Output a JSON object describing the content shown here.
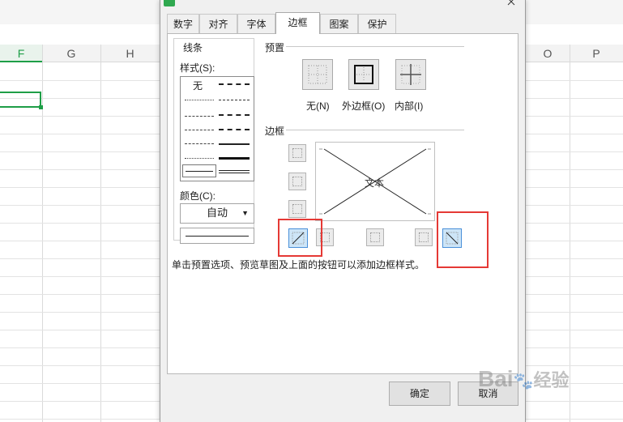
{
  "sheet": {
    "columns": [
      "F",
      "G",
      "H",
      "O",
      "P"
    ]
  },
  "dialog": {
    "tabs": [
      "数字",
      "对齐",
      "字体",
      "边框",
      "图案",
      "保护"
    ],
    "active_tab": "边框",
    "line_group": {
      "title": "线条",
      "style_label": "样式(S):",
      "none_label": "无",
      "color_label": "颜色(C):",
      "color_value": "自动"
    },
    "preset_group": {
      "title": "预置",
      "none": "无(N)",
      "outline": "外边框(O)",
      "inside": "内部(I)"
    },
    "border_group": {
      "title": "边框",
      "preview_text": "文本"
    },
    "hint": "单击预置选项、预览草图及上面的按钮可以添加边框样式。",
    "ok_label": "确定",
    "cancel_label": "取消"
  },
  "watermark": {
    "text": "Bai",
    "suffix": "经验"
  },
  "colors": {
    "selected_cell": "#1e9e47",
    "highlight": "#e53935",
    "selected_button": "#cde5f7"
  }
}
